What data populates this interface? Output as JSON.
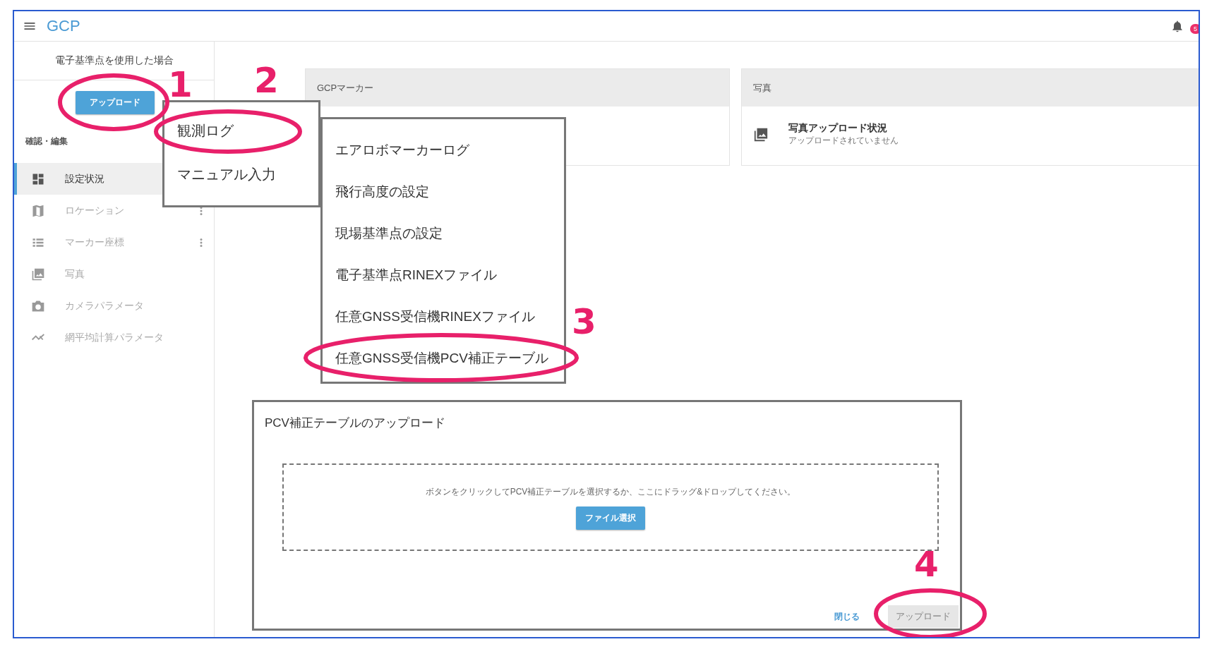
{
  "header": {
    "title": "GCP",
    "notification_count": "5"
  },
  "sidebar": {
    "heading": "電子基準点を使用した場合",
    "upload_button": "アップロード",
    "section_label": "確認・編集",
    "items": [
      {
        "label": "設定状況",
        "kind": "dashboard",
        "selected": true,
        "has_menu": false
      },
      {
        "label": "ロケーション",
        "kind": "map",
        "selected": false,
        "has_menu": true
      },
      {
        "label": "マーカー座標",
        "kind": "list",
        "selected": false,
        "has_menu": true
      },
      {
        "label": "写真",
        "kind": "photos",
        "selected": false,
        "has_menu": false
      },
      {
        "label": "カメラパラメータ",
        "kind": "camera",
        "selected": false,
        "has_menu": false
      },
      {
        "label": "網平均計算パラメータ",
        "kind": "trend",
        "selected": false,
        "has_menu": false
      }
    ]
  },
  "cards": [
    {
      "title": "GCPマーカー"
    },
    {
      "title": "写真",
      "status_title": "写真アップロード状況",
      "status_detail": "アップロードされていません"
    }
  ],
  "upload_menu": {
    "items": [
      "観測ログ",
      "マニュアル入力"
    ]
  },
  "log_submenu": {
    "items": [
      "エアロボマーカーログ",
      "飛行高度の設定",
      "現場基準点の設定",
      "電子基準点RINEXファイル",
      "任意GNSS受信機RINEXファイル",
      "任意GNSS受信機PCV補正テーブル"
    ]
  },
  "dialog": {
    "title": "PCV補正テーブルのアップロード",
    "drop_hint": "ボタンをクリックしてPCV補正テーブルを選択するか、ここにドラッグ&ドロップしてください。",
    "file_button": "ファイル選択",
    "close_link": "閉じる",
    "upload_button": {
      "label": "アップロード",
      "disabled": true
    }
  },
  "annotations": [
    {
      "number": "1"
    },
    {
      "number": "2"
    },
    {
      "number": "3"
    },
    {
      "number": "4"
    }
  ]
}
